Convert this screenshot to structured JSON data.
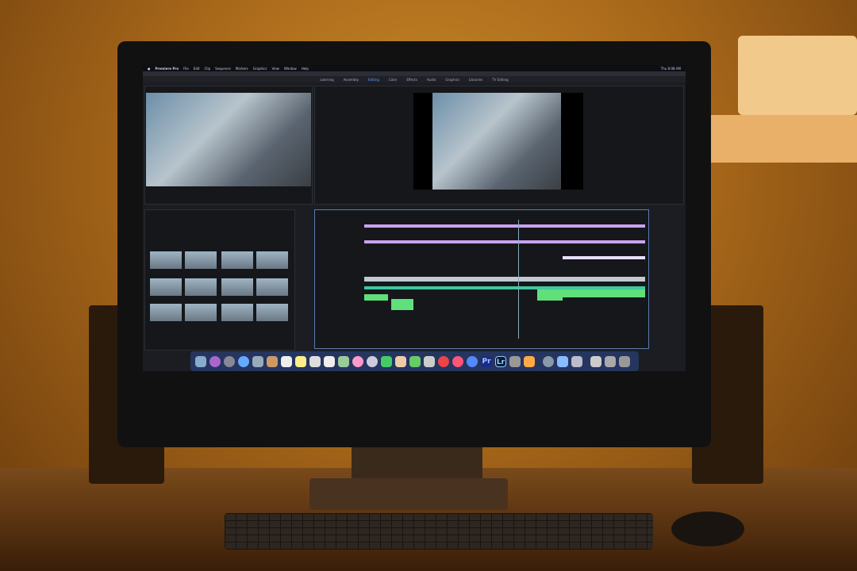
{
  "menu": {
    "apple": "",
    "app": "Premiere Pro",
    "items": [
      "File",
      "Edit",
      "Clip",
      "Sequence",
      "Markers",
      "Graphics",
      "View",
      "Window",
      "Help"
    ],
    "clock": "Thu 8:08 AM"
  },
  "workspaces": {
    "items": [
      "Learning",
      "Assembly",
      "Editing",
      "Color",
      "Effects",
      "Audio",
      "Graphics",
      "Libraries",
      "TV Editing"
    ],
    "active": "Editing"
  },
  "colors": {
    "timeline_purple": "#c9a3f0",
    "timeline_teal": "#3fc7a0",
    "timeline_green": "#5fe07a",
    "accent": "#5aa0ff"
  },
  "dock": {
    "icons": [
      "finder",
      "siri",
      "launchpad",
      "safari",
      "preview",
      "notes-book",
      "calendar",
      "stickies",
      "textedit",
      "pages",
      "maps",
      "photos",
      "messages",
      "facetime",
      "pages-2",
      "numbers",
      "keynote",
      "news",
      "music",
      "app-store",
      "premiere-pro",
      "lightroom",
      "system-preferences",
      "files",
      "quicktime",
      "downloads",
      "screenshot",
      "document",
      "stacks",
      "trash"
    ],
    "premiere_label": "Pr",
    "lightroom_label": "Lr"
  }
}
